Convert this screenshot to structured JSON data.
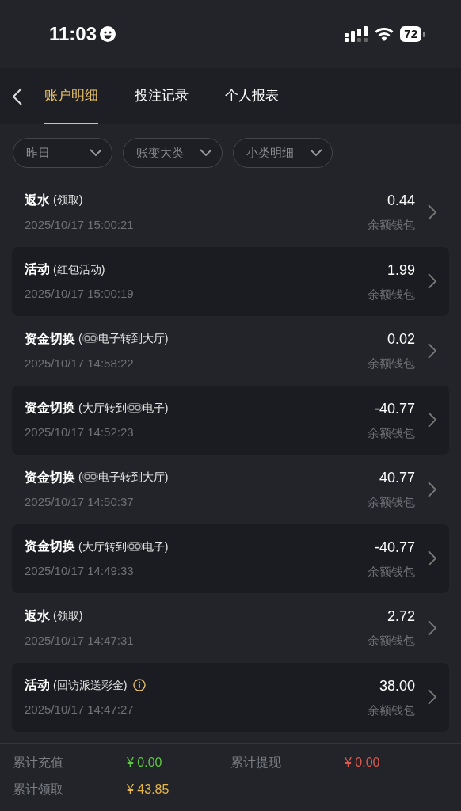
{
  "status_bar": {
    "time": "11:03",
    "battery": "72"
  },
  "tabs": [
    {
      "label": "账户明细",
      "selected": true
    },
    {
      "label": "投注记录",
      "selected": false
    },
    {
      "label": "个人报表",
      "selected": false
    }
  ],
  "filters": [
    {
      "label": "昨日"
    },
    {
      "label": "账变大类"
    },
    {
      "label": "小类明细"
    }
  ],
  "records": [
    {
      "title": "返水",
      "detail": [
        {
          "kind": "text",
          "text": "(领取)"
        }
      ],
      "time": "2025/10/17 15:00:21",
      "amount": "0.44",
      "wallet": "余额钱包",
      "info": false
    },
    {
      "title": "活动",
      "detail": [
        {
          "kind": "text",
          "text": "(红包活动)"
        }
      ],
      "time": "2025/10/17 15:00:19",
      "amount": "1.99",
      "wallet": "余额钱包",
      "info": false
    },
    {
      "title": "资金切换",
      "detail": [
        {
          "kind": "text",
          "text": "("
        },
        {
          "kind": "logo"
        },
        {
          "kind": "text",
          "text": "电子转到大厅)"
        }
      ],
      "time": "2025/10/17 14:58:22",
      "amount": "0.02",
      "wallet": "余额钱包",
      "info": false
    },
    {
      "title": "资金切换",
      "detail": [
        {
          "kind": "text",
          "text": "(大厅转到"
        },
        {
          "kind": "logo"
        },
        {
          "kind": "text",
          "text": "电子)"
        }
      ],
      "time": "2025/10/17 14:52:23",
      "amount": "-40.77",
      "wallet": "余额钱包",
      "info": false
    },
    {
      "title": "资金切换",
      "detail": [
        {
          "kind": "text",
          "text": "("
        },
        {
          "kind": "logo"
        },
        {
          "kind": "text",
          "text": "电子转到大厅)"
        }
      ],
      "time": "2025/10/17 14:50:37",
      "amount": "40.77",
      "wallet": "余额钱包",
      "info": false
    },
    {
      "title": "资金切换",
      "detail": [
        {
          "kind": "text",
          "text": "(大厅转到"
        },
        {
          "kind": "logo"
        },
        {
          "kind": "text",
          "text": "电子)"
        }
      ],
      "time": "2025/10/17 14:49:33",
      "amount": "-40.77",
      "wallet": "余额钱包",
      "info": false
    },
    {
      "title": "返水",
      "detail": [
        {
          "kind": "text",
          "text": "(领取)"
        }
      ],
      "time": "2025/10/17 14:47:31",
      "amount": "2.72",
      "wallet": "余额钱包",
      "info": false
    },
    {
      "title": "活动",
      "detail": [
        {
          "kind": "text",
          "text": "(回访派送彩金)"
        }
      ],
      "time": "2025/10/17 14:47:27",
      "amount": "38.00",
      "wallet": "余额钱包",
      "info": true
    }
  ],
  "totals": [
    {
      "label": "累计充值",
      "value": "¥ 0.00",
      "color": "#5cc93f"
    },
    {
      "label": "累计提现",
      "value": "¥ 0.00",
      "color": "#e0584c"
    },
    {
      "label": "累计领取",
      "value": "¥ 43.85",
      "color": "#e8b548"
    }
  ]
}
